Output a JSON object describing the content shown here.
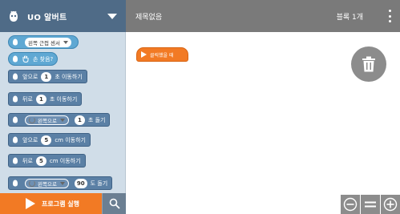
{
  "header": {
    "app_title": "UO 알버트",
    "app_icon": "robot-icon",
    "document_title": "제목없음",
    "block_count": "블록 1개",
    "menu_icon": "kebab-menu-icon"
  },
  "palette": {
    "blocks": [
      {
        "type": "sensor",
        "dropdown": "왼쪽 근접 센서"
      },
      {
        "type": "sensor",
        "icon": "hand-icon",
        "text": "손 찾음?"
      },
      {
        "before": "앞으로",
        "value": "1",
        "after": "초 이동하기"
      },
      {
        "before": "뒤로",
        "value": "1",
        "after": "초 이동하기"
      },
      {
        "dropdown": "왼쪽으로",
        "value": "1",
        "after": "초 돌기"
      },
      {
        "before": "앞으로",
        "value": "5",
        "after": "cm 이동하기"
      },
      {
        "before": "뒤로",
        "value": "5",
        "after": "cm 이동하기"
      },
      {
        "dropdown": "왼쪽으로",
        "value": "90",
        "after": "도 돌기"
      }
    ]
  },
  "footer": {
    "run_label": "프로그램 실행"
  },
  "workspace": {
    "hat_block_label": "클릭했을 때"
  },
  "colors": {
    "header_left": "#4f6b87",
    "header_right": "#7a7a7a",
    "palette_bg": "#d0dde8",
    "block_blue": "#5b80a5",
    "sensor_blue": "#5fa8d3",
    "accent_orange": "#f27a24",
    "control_gray": "#8c8c8c"
  }
}
